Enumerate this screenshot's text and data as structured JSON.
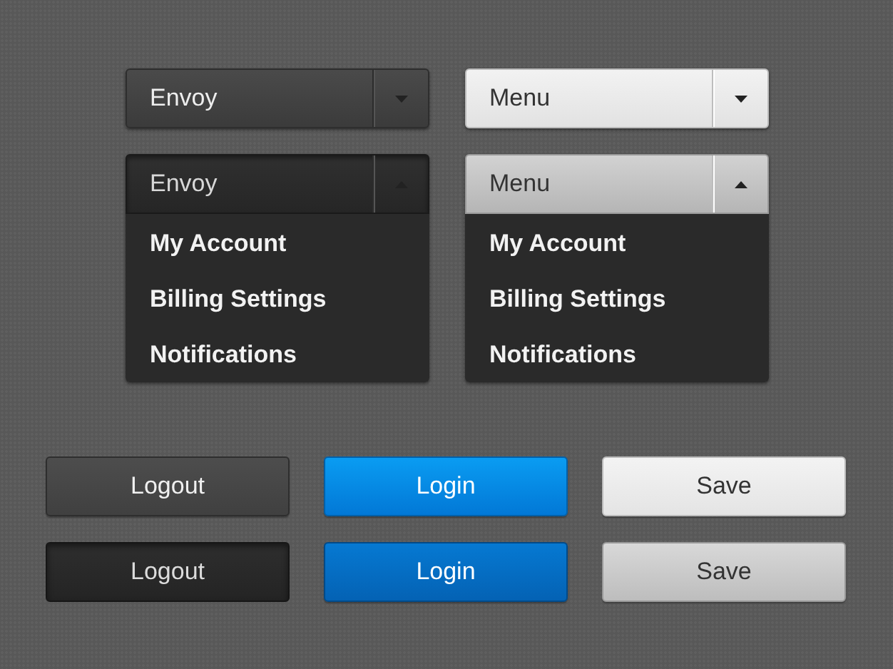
{
  "dropdowns": [
    {
      "kind": "dark",
      "label": "Envoy",
      "expanded": false
    },
    {
      "kind": "light",
      "label": "Menu",
      "expanded": false
    },
    {
      "kind": "dark",
      "label": "Envoy",
      "expanded": true,
      "items": [
        "My Account",
        "Billing Settings",
        "Notifications"
      ]
    },
    {
      "kind": "light",
      "label": "Menu",
      "expanded": true,
      "items": [
        "My Account",
        "Billing Settings",
        "Notifications"
      ]
    }
  ],
  "buttons": [
    {
      "kind": "dark",
      "label": "Logout",
      "pressed": false
    },
    {
      "kind": "blue",
      "label": "Login",
      "pressed": false
    },
    {
      "kind": "light",
      "label": "Save",
      "pressed": false
    },
    {
      "kind": "dark",
      "label": "Logout",
      "pressed": true
    },
    {
      "kind": "blue",
      "label": "Login",
      "pressed": true
    },
    {
      "kind": "light",
      "label": "Save",
      "pressed": true
    }
  ]
}
